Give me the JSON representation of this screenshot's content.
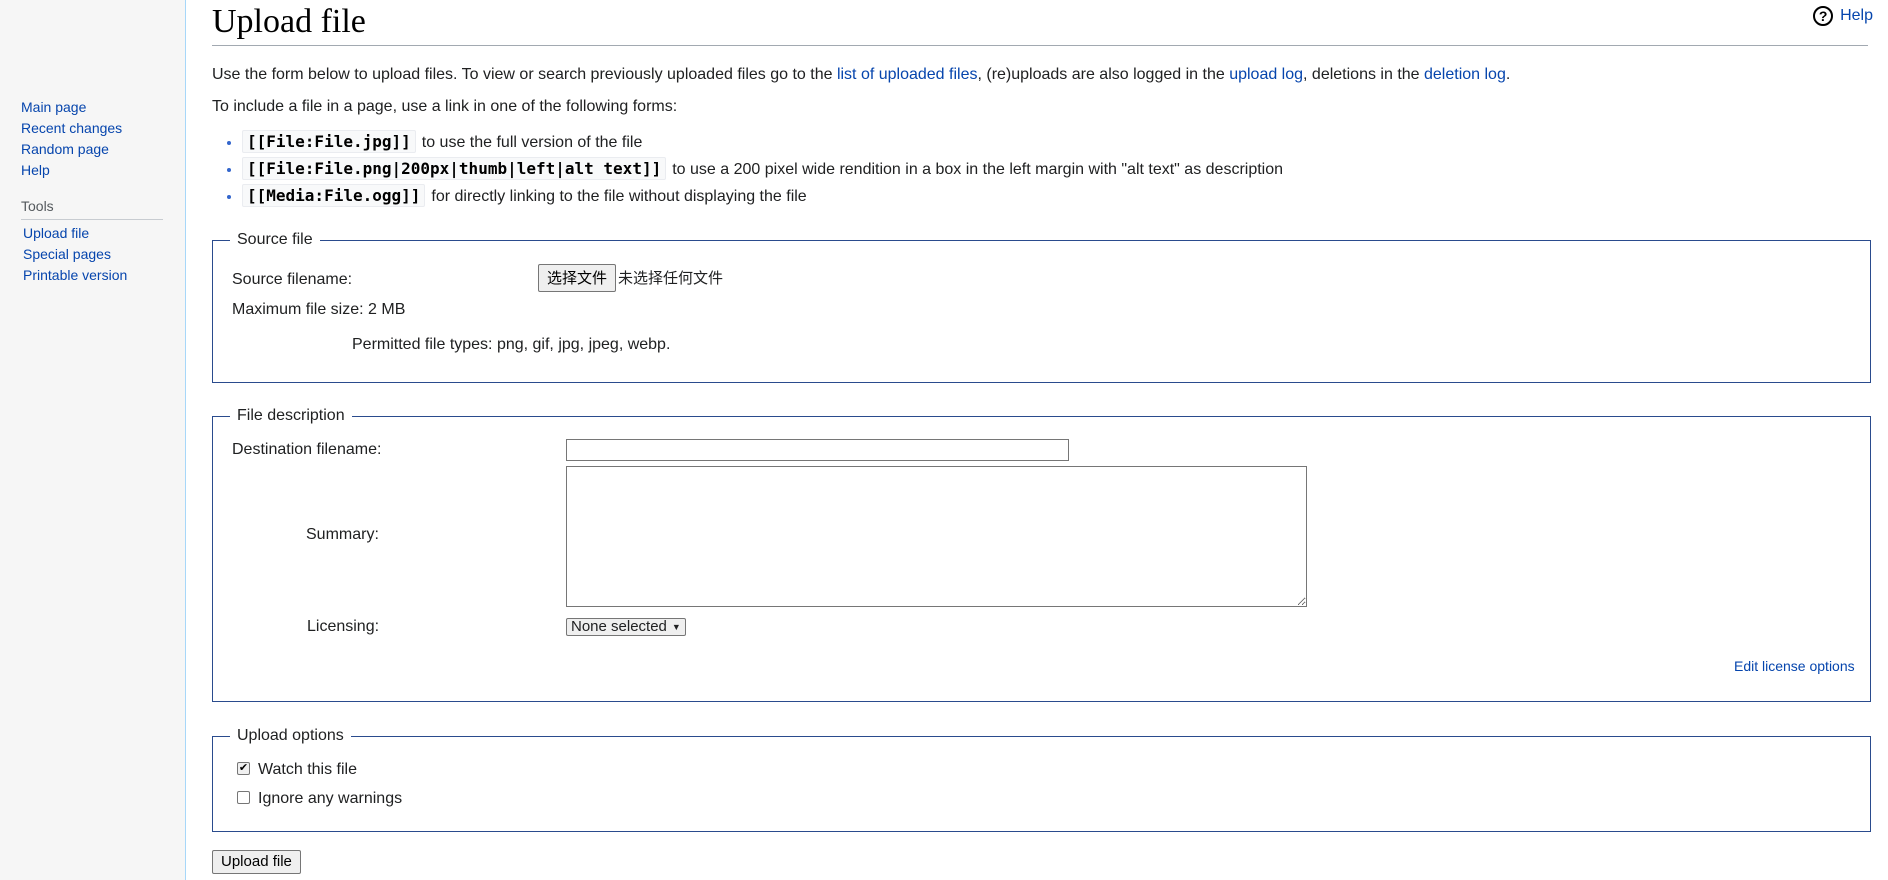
{
  "sidebar": {
    "nav": [
      {
        "label": "Main page"
      },
      {
        "label": "Recent changes"
      },
      {
        "label": "Random page"
      },
      {
        "label": "Help"
      }
    ],
    "tools_heading": "Tools",
    "tools": [
      {
        "label": "Upload file"
      },
      {
        "label": "Special pages"
      },
      {
        "label": "Printable version"
      }
    ]
  },
  "page": {
    "title": "Upload file",
    "help_label": "Help",
    "help_icon": "question-circle-icon"
  },
  "intro": {
    "text1": "Use the form below to upload files. To view or search previously uploaded files go to the ",
    "link1": "list of uploaded files",
    "text2": ", (re)uploads are also logged in the ",
    "link2": "upload log",
    "text3": ", deletions in the ",
    "link3": "deletion log",
    "text4": "."
  },
  "include_text": "To include a file in a page, use a link in one of the following forms:",
  "forms": [
    {
      "code": "[[File:File.jpg]]",
      "desc": "to use the full version of the file"
    },
    {
      "code": "[[File:File.png|200px|thumb|left|alt text]]",
      "desc": "to use a 200 pixel wide rendition in a box in the left margin with \"alt text\" as description"
    },
    {
      "code": "[[Media:File.ogg]]",
      "desc": "for directly linking to the file without displaying the file"
    }
  ],
  "source": {
    "legend": "Source file",
    "filename_label": "Source filename:",
    "choose_button": "选择文件",
    "no_file_text": "未选择任何文件",
    "max_size_text": "Maximum file size: 2 MB",
    "permitted_text": "Permitted file types: png, gif, jpg, jpeg, webp."
  },
  "description": {
    "legend": "File description",
    "dest_label": "Destination filename:",
    "dest_value": "",
    "summary_label": "Summary:",
    "summary_value": "",
    "licensing_label": "Licensing:",
    "licensing_value": "None selected",
    "edit_license_link": "Edit license options"
  },
  "options": {
    "legend": "Upload options",
    "watch_label": "Watch this file",
    "watch_checked": true,
    "ignore_label": "Ignore any warnings",
    "ignore_checked": false
  },
  "submit_label": "Upload file"
}
